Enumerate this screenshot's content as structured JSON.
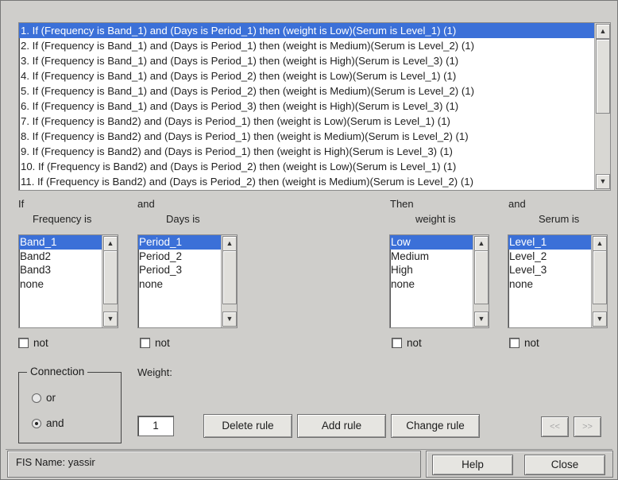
{
  "rules": [
    "1. If (Frequency is Band_1) and (Days is Period_1) then (weight is Low)(Serum is Level_1) (1)",
    "2. If (Frequency is Band_1) and (Days is Period_1) then (weight is Medium)(Serum is Level_2) (1)",
    "3. If (Frequency is Band_1) and (Days is Period_1) then (weight is High)(Serum is Level_3) (1)",
    "4. If (Frequency is Band_1) and (Days is Period_2) then (weight is Low)(Serum is Level_1) (1)",
    "5. If (Frequency is Band_1) and (Days is Period_2) then (weight is Medium)(Serum is Level_2) (1)",
    "6. If (Frequency is Band_1) and (Days is Period_3) then (weight is High)(Serum is Level_3) (1)",
    "7. If (Frequency is Band2) and (Days is Period_1) then (weight is Low)(Serum is Level_1) (1)",
    "8. If (Frequency is Band2) and (Days is Period_1) then (weight is Medium)(Serum is Level_2) (1)",
    "9. If (Frequency is Band2) and (Days is Period_1) then (weight is High)(Serum is Level_3) (1)",
    "10. If (Frequency is Band2) and (Days is Period_2) then (weight is Low)(Serum is Level_1) (1)",
    "11. If (Frequency is Band2) and (Days is Period_2) then (weight is Medium)(Serum is Level_2) (1)"
  ],
  "selected_rule_index": 0,
  "inputs": {
    "if_label": "If",
    "and_label": "and",
    "frequency": {
      "label": "Frequency is",
      "items": [
        "Band_1",
        "Band2",
        "Band3",
        "none"
      ],
      "selected": 0,
      "not_label": "not"
    },
    "days": {
      "label": "Days is",
      "items": [
        "Period_1",
        "Period_2",
        "Period_3",
        "none"
      ],
      "selected": 0,
      "not_label": "not"
    }
  },
  "outputs": {
    "then_label": "Then",
    "and_label": "and",
    "weight": {
      "label": "weight is",
      "items": [
        "Low",
        "Medium",
        "High",
        "none"
      ],
      "selected": 0,
      "not_label": "not"
    },
    "serum": {
      "label": "Serum is",
      "items": [
        "Level_1",
        "Level_2",
        "Level_3",
        "none"
      ],
      "selected": 0,
      "not_label": "not"
    }
  },
  "connection": {
    "title": "Connection",
    "or_label": "or",
    "and_label": "and",
    "selected": "and"
  },
  "weight_field": {
    "label": "Weight:",
    "value": "1"
  },
  "buttons": {
    "delete": "Delete rule",
    "add": "Add rule",
    "change": "Change rule",
    "prev": "<<",
    "next": ">>"
  },
  "status": {
    "fis_name": "FIS Name: yassir"
  },
  "footer_buttons": {
    "help": "Help",
    "close": "Close"
  },
  "icons": {
    "scroll_up": "arrow-up-icon",
    "scroll_down": "arrow-down-icon"
  }
}
